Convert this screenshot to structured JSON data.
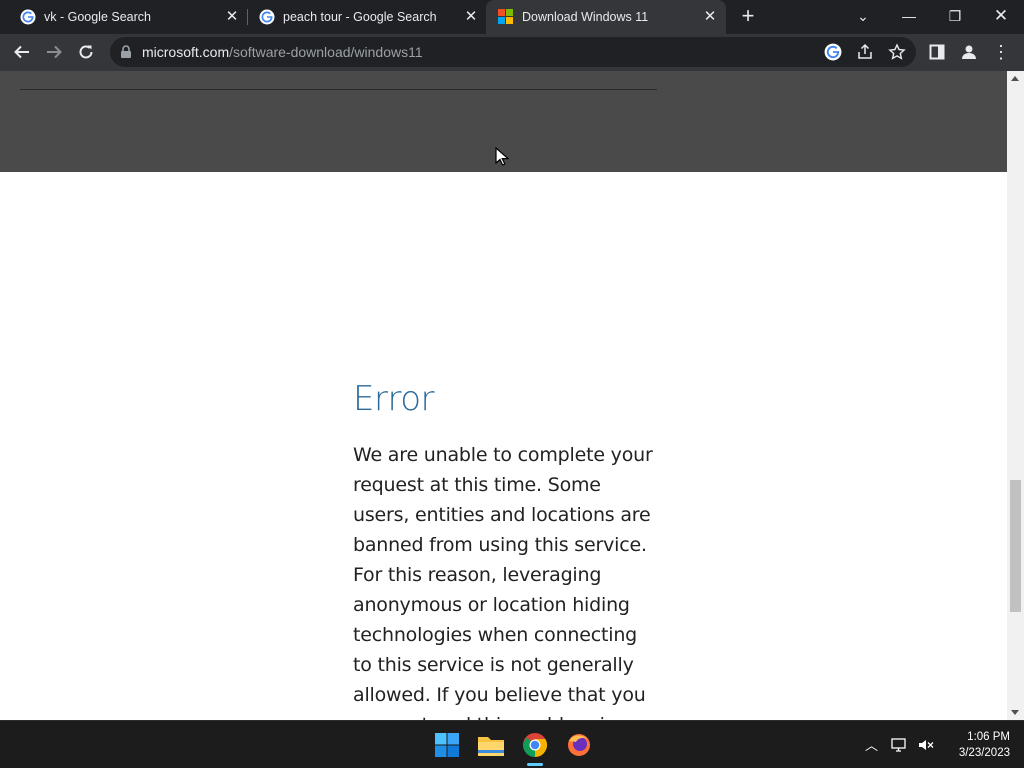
{
  "browser": {
    "tabs": [
      {
        "title": "vk - Google Search",
        "favicon": "google-g-icon",
        "active": false
      },
      {
        "title": "peach tour - Google Search",
        "favicon": "google-g-icon",
        "active": false
      },
      {
        "title": "Download Windows 11",
        "favicon": "microsoft-logo-icon",
        "active": true
      }
    ],
    "url": {
      "host": "microsoft.com",
      "path": "/software-download/windows11"
    }
  },
  "page": {
    "error_heading": "Error",
    "error_text": "We are unable to complete your request at this time. Some users, entities and locations are banned from using this service. For this reason, leveraging anonymous or location hiding technologies when connecting to this service is not generally allowed. If you believe that you encountered this problem in error, please try again."
  },
  "taskbar": {
    "apps": [
      "start-button",
      "file-explorer",
      "chrome",
      "firefox"
    ],
    "time": "1:06 PM",
    "date": "3/23/2023"
  },
  "colors": {
    "accent": "#2b6a9b",
    "active_tab": "#35363a",
    "tab_strip": "#202124"
  }
}
